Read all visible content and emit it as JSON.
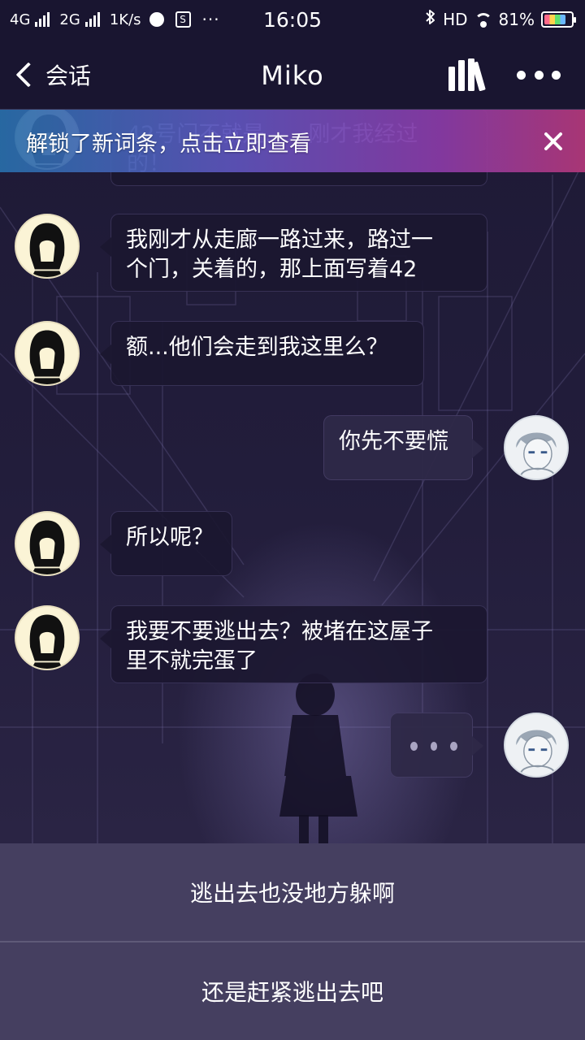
{
  "status_bar": {
    "network_1": "4G",
    "network_2": "2G",
    "speed": "1K/s",
    "time": "16:05",
    "hd": "HD",
    "battery": "81%"
  },
  "nav": {
    "back_label": "会话",
    "title": "Miko"
  },
  "banner": {
    "text": "解锁了新词条，点击立即查看",
    "close_glyph": "✕",
    "obscured_message": "42号门不就是……刚才我经过的！"
  },
  "messages": [
    {
      "sender": "miko",
      "text": "我刚才从走廊一路过来，路过一个门，关着的，那上面写着42"
    },
    {
      "sender": "miko",
      "text": "额...他们会走到我这里么？"
    },
    {
      "sender": "me",
      "text": "你先不要慌"
    },
    {
      "sender": "miko",
      "text": "所以呢？"
    },
    {
      "sender": "miko",
      "text": "我要不要逃出去？被堵在这屋子里不就完蛋了"
    },
    {
      "sender": "me",
      "typing": true
    }
  ],
  "message_lines": {
    "m0_line1": "我刚才从走廊一路过来，路过一",
    "m0_line2": "个门，关着的，那上面写着42",
    "m4_line1": "我要不要逃出去？被堵在这屋子",
    "m4_line2": "里不就完蛋了",
    "ghost_line1": "42号门不就是……刚才我经过",
    "ghost_line2": "的！"
  },
  "reply_options": [
    "逃出去也没地方躲啊",
    "还是赶紧逃出去吧"
  ],
  "icons": {
    "back": "chevron-left-icon",
    "library": "books-icon",
    "more": "more-dots-icon",
    "close": "close-icon"
  },
  "colors": {
    "nav_background": "#191530",
    "chat_background": "#221d3b",
    "bubble_background": "#1b1730",
    "reply_background": "#453f60",
    "banner_start": "#286eaa",
    "banner_end": "#af3778"
  }
}
